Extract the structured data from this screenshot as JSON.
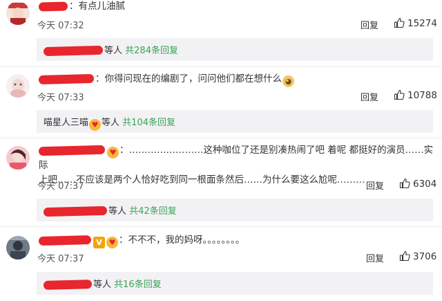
{
  "reply_label": "回复",
  "comments": [
    {
      "text": "有点儿油腻",
      "time": "今天 07:32",
      "likes": "15274",
      "sub": {
        "suffix": "等人",
        "total": "共284条回复"
      }
    },
    {
      "text": "你得问现在的编剧了，问问他们都在想什么",
      "time": "今天 07:33",
      "likes": "10788",
      "sub": {
        "name": "喵星人三喵",
        "suffix": "等人",
        "total": "共104条回复"
      }
    },
    {
      "text_line1": "……………………这种咖位了还是别凑热闹了吧 着呢 都挺好的演员……实际",
      "text_line2": "上吧……不应该是两个人恰好吃到同一根面条然后……为什么要这么尬呢………",
      "time": "今天 07:37",
      "likes": "6304",
      "sub": {
        "suffix": "等人",
        "total": "共42条回复"
      }
    },
    {
      "text": "不不不，我的妈呀。。。。。。。。",
      "time": "今天 07:37",
      "likes": "3706",
      "sub": {
        "suffix": "等人",
        "total": "共16条回复"
      }
    }
  ],
  "icons": {
    "like": "thumbs-up-icon",
    "love_emoji": "heart-eyes-emoji",
    "doge_emoji": "doge-emoji",
    "vip_badge": "vip-badge"
  },
  "colors": {
    "redaction": "#e8262d",
    "reply_count": "#3aa354",
    "sub_box_bg": "#f2f2f5"
  }
}
